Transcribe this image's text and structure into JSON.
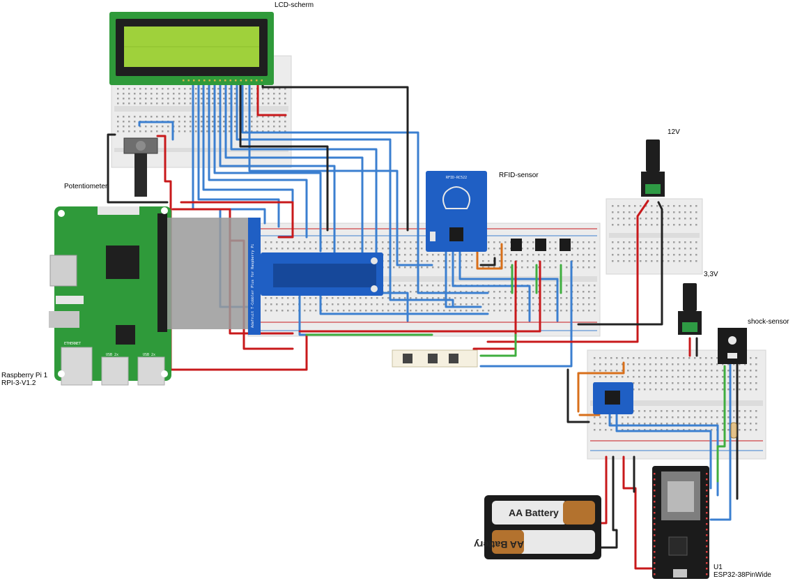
{
  "labels": {
    "lcd": "LCD-scherm",
    "potentiometer": "Potentiometer",
    "rpi_line1": "Raspberry Pi 1",
    "rpi_line2": "RPI-3-V1.2",
    "rfid": "RFID-sensor",
    "v12": "12V",
    "v33": "3,3V",
    "shock": "shock-sensor",
    "esp_line1": "U1",
    "esp_line2": "ESP32-38PinWide",
    "aa1": "AA Battery",
    "aa2": "AA Battery"
  },
  "board_text": {
    "cobbler": "Adafruit T-Cobbler Plus for Raspberry Pi",
    "rfid_chip": "RFID-RC522",
    "usb1": "USB 2x",
    "usb2": "USB 2x",
    "ethernet": "ETHERNET"
  },
  "colors": {
    "wire_blue": "#3b7fd0",
    "wire_red": "#c8191b",
    "wire_black": "#222222",
    "wire_green": "#3fae3f",
    "wire_orange": "#d86f1a",
    "pcb_green": "#2f9a3a",
    "pcb_blue": "#1f5fc4",
    "esp_black": "#1b1b1b",
    "lcd_green": "#9fd13b"
  }
}
